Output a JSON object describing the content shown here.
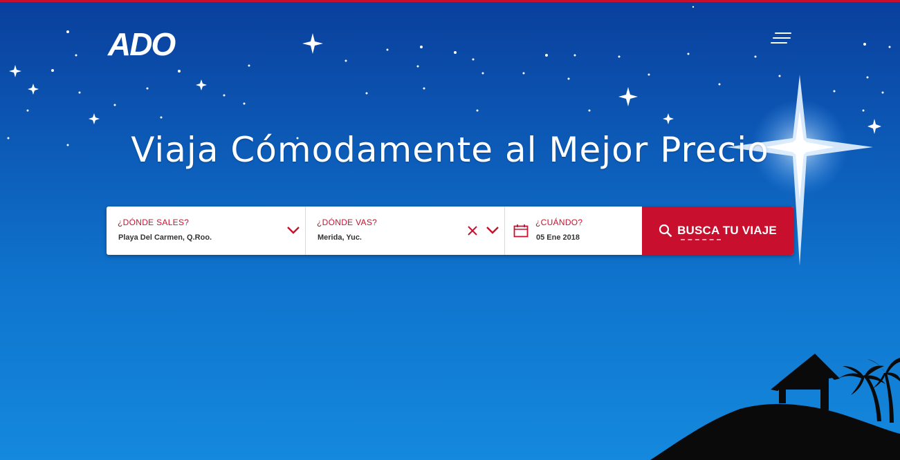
{
  "brand": {
    "logo_text": "ADO"
  },
  "hero": {
    "headline": "Viaja Cómodamente al Mejor Precio"
  },
  "search": {
    "origin": {
      "label": "¿DÓNDE SALES?",
      "value": "Playa Del Carmen, Q.Roo."
    },
    "destination": {
      "label": "¿DÓNDE VAS?",
      "value": "Merida, Yuc."
    },
    "date": {
      "label": "¿CUÁNDO?",
      "value": "05 Ene 2018"
    },
    "button_label": "BUSCA TU VIAJE"
  },
  "colors": {
    "accent": "#c8102e",
    "sky_top": "#0a3f9c",
    "sky_bottom": "#1489dd"
  },
  "icons": [
    "menu-icon",
    "chevron-down-icon",
    "clear-icon",
    "calendar-icon",
    "search-icon"
  ]
}
